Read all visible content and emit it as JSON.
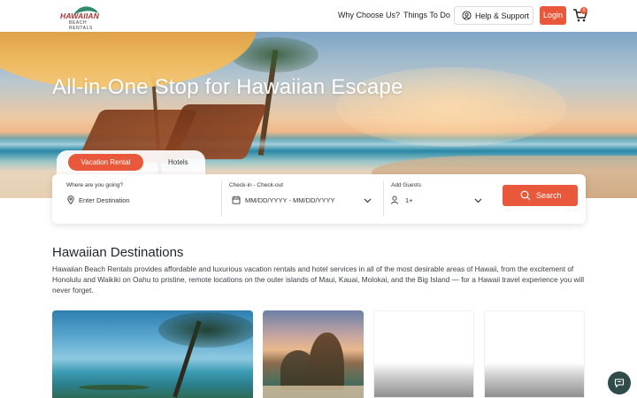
{
  "header": {
    "logo_text": "HAWAIIAN",
    "logo_subtext": "BEACH RENTALS",
    "nav": [
      {
        "label": "Why Choose Us?"
      },
      {
        "label": "Things To Do"
      }
    ],
    "help_label": "Help & Support",
    "login_label": "Login",
    "cart_count": "0"
  },
  "hero": {
    "title": "All-in-One Stop for Hawaiian Escape"
  },
  "tabs": {
    "items": [
      "Vacation Rental",
      "Hotels"
    ],
    "active": "Vacation Rental"
  },
  "search": {
    "where_label": "Where are you going?",
    "where_placeholder": "Enter Destination",
    "dates_label": "Check-in - Check-out",
    "dates_placeholder": "MM/DD/YYYY - MM/DD/YYYY",
    "guests_label": "Add Guests",
    "guests_value": "1+",
    "search_label": "Search"
  },
  "destinations": {
    "title": "Hawaiian Destinations",
    "description": "Hawaiian Beach Rentals provides affordable and luxurious vacation rentals and hotel services in all of the most desirable areas of Hawaii, from the excitement of Honolulu and Waikiki on Oahu to pristine, remote locations on the outer islands of Maui, Kauai, Molokai, and the Big Island — for a Hawaii travel experience you will never forget."
  },
  "colors": {
    "accent": "#e9583a",
    "chat_button": "#2f4b4a"
  },
  "icons": [
    "support-icon",
    "cart-icon",
    "location-pin-icon",
    "calendar-icon",
    "user-icon",
    "chevron-down-icon",
    "search-icon",
    "chat-icon"
  ]
}
